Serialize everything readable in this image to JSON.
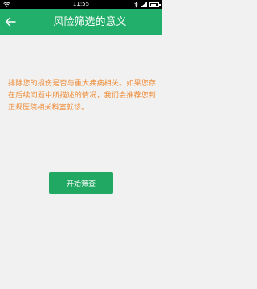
{
  "status_bar": {
    "time": "11:55",
    "icons": [
      "wifi-icon",
      "bluetooth-icon",
      "signal-icon",
      "battery-icon"
    ],
    "battery_level": 0.7
  },
  "header": {
    "title": "风险筛选的意义",
    "back_icon": "arrow-left-icon",
    "color": "#22ae6b"
  },
  "main": {
    "description": "排除您的损伤是否与重大疾病相关。如果您存在后续问题中所描述的情况，我们会推荐您到正规医院相关科室就诊。",
    "description_color": "#f08a33",
    "start_button": "开始筛查"
  }
}
